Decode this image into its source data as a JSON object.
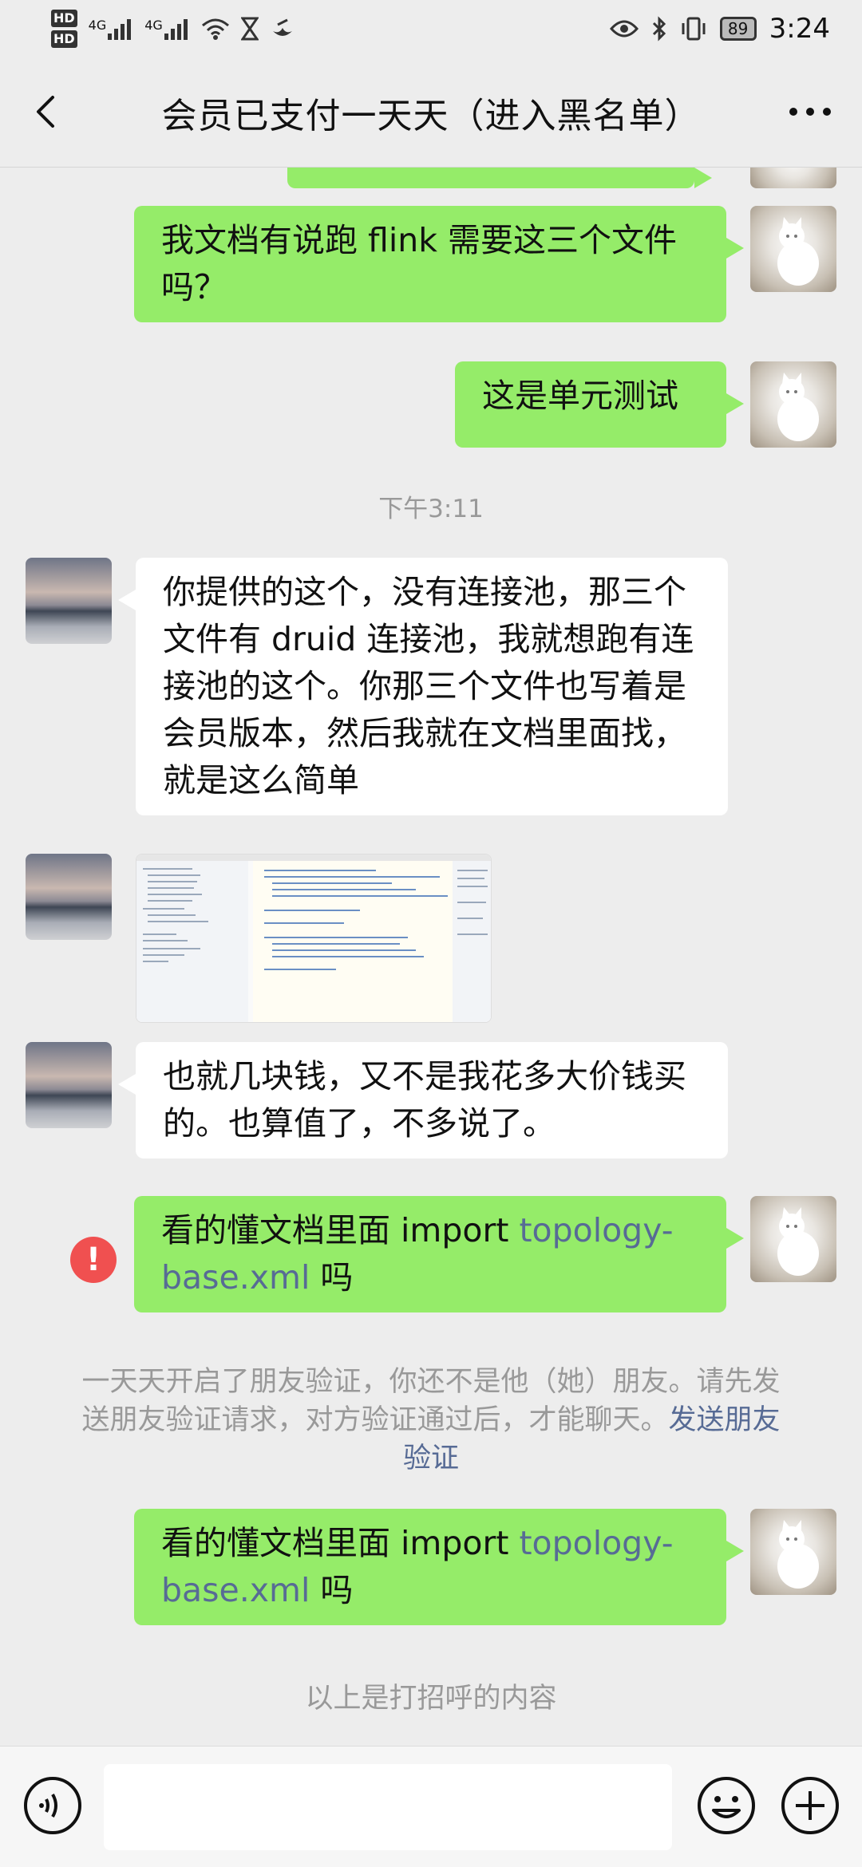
{
  "status_bar": {
    "hd1": "HD",
    "hd2": "HD",
    "network1": "4G",
    "network2": "4G",
    "battery": "89",
    "time": "3:24"
  },
  "header": {
    "title": "会员已支付一天天（进入黑名单）",
    "back_icon": "chevron-left-icon",
    "more_icon": "more-dots-icon"
  },
  "messages": [
    {
      "type": "text",
      "side": "self",
      "text": "我文档有说跑 flink 需要这三个文件吗？"
    },
    {
      "type": "text",
      "side": "self",
      "text": "这是单元测试"
    },
    {
      "type": "time",
      "text": "下午3:11"
    },
    {
      "type": "text",
      "side": "other",
      "text": "你提供的这个，没有连接池，那三个文件有 druid 连接池，我就想跑有连接池的这个。你那三个文件也写着是会员版本，然后我就在文档里面找，就是这么简单"
    },
    {
      "type": "image",
      "side": "other",
      "description": "screenshot-thumbnail"
    },
    {
      "type": "text",
      "side": "other",
      "text": "也就几块钱，又不是我花多大价钱买的。也算值了，不多说了。"
    },
    {
      "type": "text",
      "side": "self",
      "status": "failed",
      "prefix": "看的懂文档里面 import ",
      "link": "topology-base.xml",
      "suffix": " 吗"
    },
    {
      "type": "system",
      "text": "一天天开启了朋友验证，你还不是他（她）朋友。请先发送朋友验证请求，对方验证通过后，才能聊天。",
      "link": "发送朋友验证"
    },
    {
      "type": "text",
      "side": "self",
      "prefix": "看的懂文档里面 import ",
      "link": "topology-base.xml",
      "suffix": " 吗"
    },
    {
      "type": "system",
      "text": "以上是打招呼的内容"
    }
  ],
  "input_bar": {
    "voice_icon": "voice-icon",
    "emoji_icon": "emoji-icon",
    "plus_icon": "plus-icon",
    "input_value": ""
  },
  "colors": {
    "background": "#ededed",
    "self_bubble": "#95ec69",
    "other_bubble": "#ffffff",
    "link": "#576b95",
    "error": "#f05050"
  }
}
